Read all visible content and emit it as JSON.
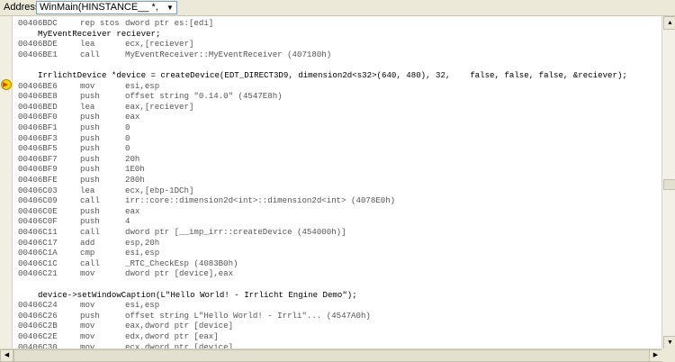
{
  "address_bar": {
    "label": "Address:",
    "value": "WinMain(HINSTANCE__ *, HINSTANC",
    "dropdown_icon": "chevron-down-icon"
  },
  "disassembly": [
    {
      "type": "asm",
      "addr": "00406BDC",
      "mnemonic": "rep stos",
      "operands": "dword ptr es:[edi]"
    },
    {
      "type": "src",
      "text": "MyEventReceiver reciever;"
    },
    {
      "type": "asm",
      "addr": "00406BDE",
      "mnemonic": "lea",
      "operands": "ecx,[reciever]"
    },
    {
      "type": "asm",
      "addr": "00406BE1",
      "mnemonic": "call",
      "operands": "MyEventReceiver::MyEventReceiver (407180h)"
    },
    {
      "type": "blank"
    },
    {
      "type": "src",
      "text": "IrrlichtDevice *device = createDevice(EDT_DIRECT3D9, dimension2d<s32>(640, 480), 32,    false, false, false, &reciever);"
    },
    {
      "type": "asm",
      "addr": "00406BE6",
      "mnemonic": "mov",
      "operands": "esi,esp",
      "current": true
    },
    {
      "type": "asm",
      "addr": "00406BE8",
      "mnemonic": "push",
      "operands": "offset string \"0.14.0\" (4547E8h)"
    },
    {
      "type": "asm",
      "addr": "00406BED",
      "mnemonic": "lea",
      "operands": "eax,[reciever]"
    },
    {
      "type": "asm",
      "addr": "00406BF0",
      "mnemonic": "push",
      "operands": "eax"
    },
    {
      "type": "asm",
      "addr": "00406BF1",
      "mnemonic": "push",
      "operands": "0"
    },
    {
      "type": "asm",
      "addr": "00406BF3",
      "mnemonic": "push",
      "operands": "0"
    },
    {
      "type": "asm",
      "addr": "00406BF5",
      "mnemonic": "push",
      "operands": "0"
    },
    {
      "type": "asm",
      "addr": "00406BF7",
      "mnemonic": "push",
      "operands": "20h"
    },
    {
      "type": "asm",
      "addr": "00406BF9",
      "mnemonic": "push",
      "operands": "1E0h"
    },
    {
      "type": "asm",
      "addr": "00406BFE",
      "mnemonic": "push",
      "operands": "280h"
    },
    {
      "type": "asm",
      "addr": "00406C03",
      "mnemonic": "lea",
      "operands": "ecx,[ebp-1DCh]"
    },
    {
      "type": "asm",
      "addr": "00406C09",
      "mnemonic": "call",
      "operands": "irr::core::dimension2d<int>::dimension2d<int> (4078E0h)"
    },
    {
      "type": "asm",
      "addr": "00406C0E",
      "mnemonic": "push",
      "operands": "eax"
    },
    {
      "type": "asm",
      "addr": "00406C0F",
      "mnemonic": "push",
      "operands": "4"
    },
    {
      "type": "asm",
      "addr": "00406C11",
      "mnemonic": "call",
      "operands": "dword ptr [__imp_irr::createDevice (454000h)]"
    },
    {
      "type": "asm",
      "addr": "00406C17",
      "mnemonic": "add",
      "operands": "esp,20h"
    },
    {
      "type": "asm",
      "addr": "00406C1A",
      "mnemonic": "cmp",
      "operands": "esi,esp"
    },
    {
      "type": "asm",
      "addr": "00406C1C",
      "mnemonic": "call",
      "operands": "_RTC_CheckEsp (4083B0h)"
    },
    {
      "type": "asm",
      "addr": "00406C21",
      "mnemonic": "mov",
      "operands": "dword ptr [device],eax"
    },
    {
      "type": "blank"
    },
    {
      "type": "src",
      "text": "device->setWindowCaption(L\"Hello World! - Irrlicht Engine Demo\");"
    },
    {
      "type": "asm",
      "addr": "00406C24",
      "mnemonic": "mov",
      "operands": "esi,esp"
    },
    {
      "type": "asm",
      "addr": "00406C26",
      "mnemonic": "push",
      "operands": "offset string L\"Hello World! - Irrli\"... (4547A0h)"
    },
    {
      "type": "asm",
      "addr": "00406C2B",
      "mnemonic": "mov",
      "operands": "eax,dword ptr [device]"
    },
    {
      "type": "asm",
      "addr": "00406C2E",
      "mnemonic": "mov",
      "operands": "edx,dword ptr [eax]"
    },
    {
      "type": "asm",
      "addr": "00406C30",
      "mnemonic": "mov",
      "operands": "ecx,dword ptr [device]"
    }
  ],
  "instruction_pointer_icon": "current-instruction-arrow-icon",
  "scrollbars": {
    "up_icon": "scroll-up-arrow-icon",
    "down_icon": "scroll-down-arrow-icon",
    "left_icon": "scroll-left-arrow-icon",
    "right_icon": "scroll-right-arrow-icon"
  }
}
